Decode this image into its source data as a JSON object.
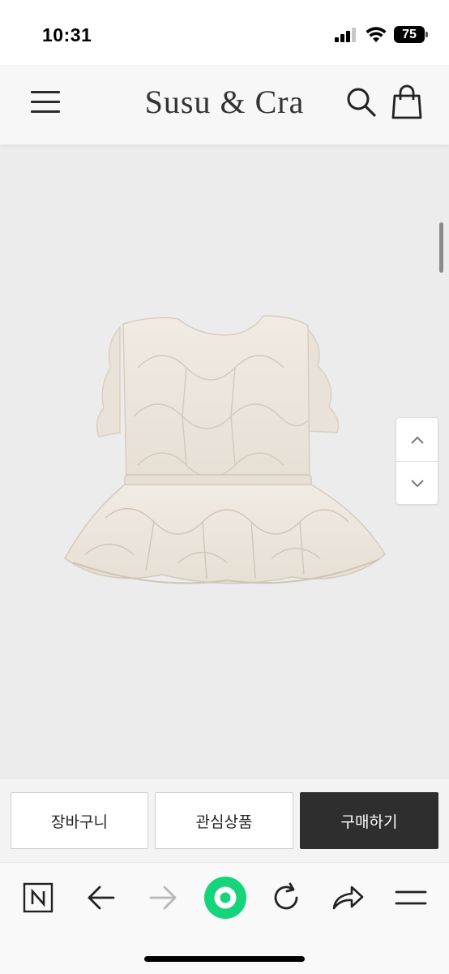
{
  "status_bar": {
    "time": "10:31",
    "battery": "75",
    "icons": [
      "signal-icon",
      "wifi-icon",
      "battery-icon"
    ]
  },
  "header": {
    "brand": "Susu & Cra",
    "icons": [
      "menu-icon",
      "search-icon",
      "shopping-bag-icon"
    ]
  },
  "product": {
    "image_subject": "quilted peplum vest",
    "colors": {
      "background": "#ececec",
      "garment": "#ece6dd"
    },
    "scroll_buttons": [
      "chevron-up-icon",
      "chevron-down-icon"
    ]
  },
  "actions": {
    "cart_label": "장바구니",
    "wishlist_label": "관심상품",
    "buy_label": "구매하기",
    "buy_color": "#2e2e2e"
  },
  "browser": {
    "tools": [
      "naver-n-icon",
      "back-arrow-icon",
      "forward-arrow-icon",
      "green-home-icon",
      "refresh-icon",
      "share-icon",
      "menu-lines-icon"
    ],
    "accent": "#16d47b"
  }
}
